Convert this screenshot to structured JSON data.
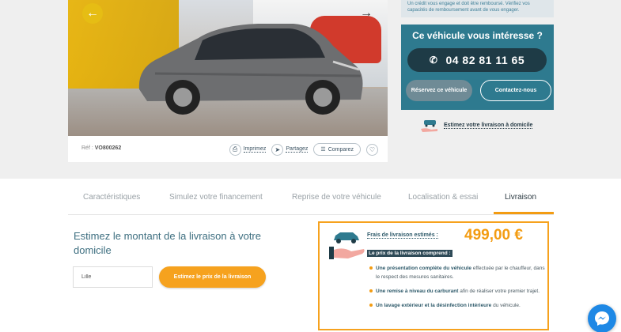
{
  "colors": {
    "accent": "#f39c12",
    "teal": "#2e7a8f",
    "navy": "#1e3b46"
  },
  "vehicle": {
    "ref_label": "Réf :",
    "ref_value": "VO800262",
    "print_label": "Imprimez",
    "share_label": "Partagez",
    "compare_label": "Comparez"
  },
  "credit_note": "Un crédit vous engage et doit être remboursé. Vérifiez vos capacités de remboursement avant de vous engager.",
  "interest": {
    "title": "Ce véhicule vous intéresse ?",
    "phone": "04 82 81 11 65",
    "reserve_label": "Réservez ce véhicule",
    "contact_label": "Contactez-nous"
  },
  "delivery_link": "Estimez votre livraison à domicile",
  "tabs": [
    {
      "label": "Caractéristiques"
    },
    {
      "label": "Simulez votre financement"
    },
    {
      "label": "Reprise de votre véhicule"
    },
    {
      "label": "Localisation & essai"
    },
    {
      "label": "Livraison"
    }
  ],
  "estimate": {
    "title": "Estimez le montant de la livraison à votre domicile",
    "input_value": "Lille",
    "button_label": "Estimez le prix de la livraison"
  },
  "fees": {
    "label": "Frais de livraison estimés :",
    "price": "499,00 €",
    "includes_label": "Le prix de la livraison comprend :",
    "items": [
      {
        "bold": "Une présentation complète du véhicule",
        "rest": " effectuée par le chauffeur, dans le respect des mesures sanitaires."
      },
      {
        "bold": "Une remise à niveau du carburant",
        "rest": " afin de réaliser votre premier trajet."
      },
      {
        "bold": "Un lavage extérieur et la désinfection intérieure",
        "rest": " du véhicule."
      }
    ]
  }
}
